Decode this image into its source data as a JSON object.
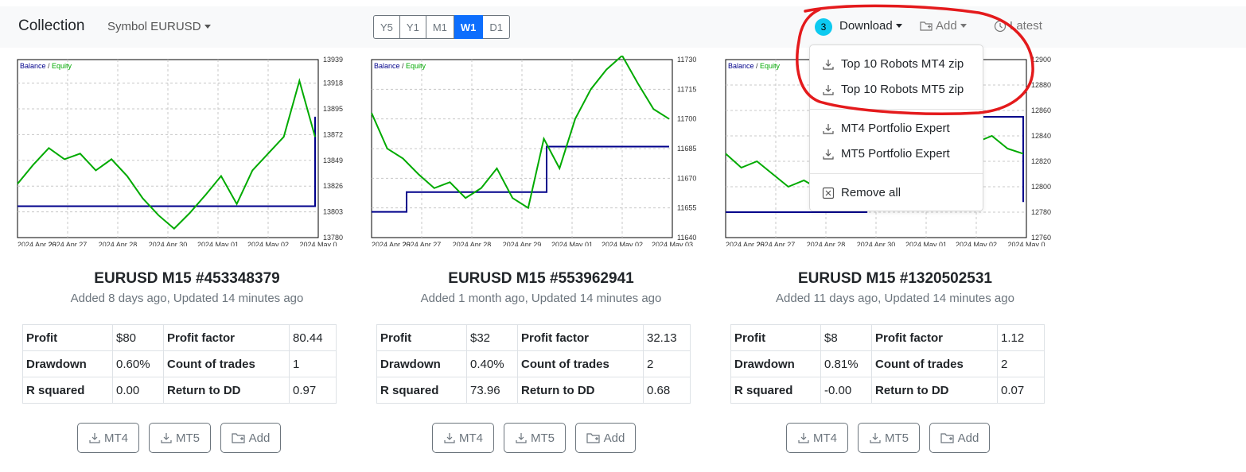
{
  "navbar": {
    "brand": "Collection",
    "symbol_label": "Symbol EURUSD",
    "periods": [
      {
        "label": "Y5",
        "active": false
      },
      {
        "label": "Y1",
        "active": false
      },
      {
        "label": "M1",
        "active": false
      },
      {
        "label": "W1",
        "active": true
      },
      {
        "label": "D1",
        "active": false
      }
    ],
    "badge_count": "3",
    "download_label": "Download",
    "add_label": "Add",
    "latest_label": "Latest"
  },
  "dropdown": {
    "items": [
      "Top 10 Robots MT4 zip",
      "Top 10 Robots MT5 zip",
      "MT4 Portfolio Expert",
      "MT5 Portfolio Expert",
      "Remove all"
    ]
  },
  "chart_legend": {
    "balance": "Balance",
    "separator": " / ",
    "equity": "Equity"
  },
  "colors": {
    "balance": "#00008b",
    "equity": "#00aa00",
    "accent": "#0d6efd",
    "badge": "#0dcaf0",
    "annotation": "#e41a1c"
  },
  "cards": [
    {
      "title": "EURUSD M15 #453348379",
      "subtitle": "Added 8 days ago, Updated 14 minutes ago",
      "stats": [
        [
          "Profit",
          "$80",
          "Profit factor",
          "80.44"
        ],
        [
          "Drawdown",
          "0.60%",
          "Count of trades",
          "1"
        ],
        [
          "R squared",
          "0.00",
          "Return to DD",
          "0.97"
        ]
      ],
      "buttons": [
        "MT4",
        "MT5",
        "Add"
      ],
      "chart_data": {
        "type": "line",
        "x_labels": [
          "2024 Apr 26",
          "2024 Apr 27",
          "2024 Apr 28",
          "2024 Apr 30",
          "2024 May 01",
          "2024 May 02",
          "2024 May 0"
        ],
        "y_ticks": [
          13939,
          13918,
          13895,
          13872,
          13849,
          13826,
          13803,
          13780
        ],
        "ylim": [
          13780,
          13939
        ],
        "series": [
          {
            "name": "Balance",
            "values": [
              13808,
              13808,
              13808,
              13808,
              13808,
              13808,
              13808,
              13808,
              13808,
              13808,
              13808,
              13808,
              13808,
              13808,
              13808,
              13808,
              13808,
              13808,
              13888
            ]
          },
          {
            "name": "Equity",
            "values": [
              13828,
              13845,
              13860,
              13850,
              13855,
              13840,
              13850,
              13835,
              13815,
              13800,
              13788,
              13802,
              13818,
              13835,
              13810,
              13840,
              13855,
              13870,
              13920,
              13870
            ]
          }
        ]
      }
    },
    {
      "title": "EURUSD M15 #553962941",
      "subtitle": "Added 1 month ago, Updated 14 minutes ago",
      "stats": [
        [
          "Profit",
          "$32",
          "Profit factor",
          "32.13"
        ],
        [
          "Drawdown",
          "0.40%",
          "Count of trades",
          "2"
        ],
        [
          "R squared",
          "73.96",
          "Return to DD",
          "0.68"
        ]
      ],
      "buttons": [
        "MT4",
        "MT5",
        "Add"
      ],
      "chart_data": {
        "type": "line",
        "x_labels": [
          "2024 Apr 26",
          "2024 Apr 27",
          "2024 Apr 28",
          "2024 Apr 29",
          "2024 May 01",
          "2024 May 02",
          "2024 May 03"
        ],
        "y_ticks": [
          11730,
          11715,
          11700,
          11685,
          11670,
          11655,
          11640
        ],
        "ylim": [
          11640,
          11730
        ],
        "series": [
          {
            "name": "Balance",
            "values": [
              11653,
              11653,
              11663,
              11663,
              11663,
              11663,
              11663,
              11663,
              11663,
              11663,
              11686,
              11686,
              11686,
              11686,
              11686,
              11686,
              11686,
              11686
            ]
          },
          {
            "name": "Equity",
            "values": [
              11703,
              11685,
              11680,
              11672,
              11665,
              11668,
              11660,
              11665,
              11675,
              11660,
              11655,
              11690,
              11675,
              11700,
              11715,
              11725,
              11732,
              11718,
              11705,
              11700
            ]
          }
        ]
      }
    },
    {
      "title": "EURUSD M15 #1320502531",
      "subtitle": "Added 11 days ago, Updated 14 minutes ago",
      "stats": [
        [
          "Profit",
          "$8",
          "Profit factor",
          "1.12"
        ],
        [
          "Drawdown",
          "0.81%",
          "Count of trades",
          "2"
        ],
        [
          "R squared",
          "-0.00",
          "Return to DD",
          "0.07"
        ]
      ],
      "buttons": [
        "MT4",
        "MT5",
        "Add"
      ],
      "chart_data": {
        "type": "line",
        "x_labels": [
          "2024 Apr 26",
          "2024 Apr 27",
          "2024 Apr 28",
          "2024 Apr 30",
          "2024 May 01",
          "2024 May 02",
          "2024 May 0"
        ],
        "y_ticks": [
          12900,
          12880,
          12860,
          12840,
          12820,
          12800,
          12780,
          12760
        ],
        "ylim": [
          12760,
          12900
        ],
        "series": [
          {
            "name": "Balance",
            "values": [
              12780,
              12780,
              12780,
              12780,
              12780,
              12780,
              12780,
              12780,
              12780,
              12855,
              12855,
              12855,
              12855,
              12855,
              12855,
              12855,
              12855,
              12855,
              12855,
              12788
            ]
          },
          {
            "name": "Equity",
            "values": [
              12826,
              12815,
              12820,
              12810,
              12800,
              12805,
              12798,
              12808,
              12810,
              12835,
              12850,
              12855,
              12852,
              12845,
              12838,
              12842,
              12835,
              12840,
              12830,
              12826
            ]
          }
        ]
      }
    }
  ]
}
